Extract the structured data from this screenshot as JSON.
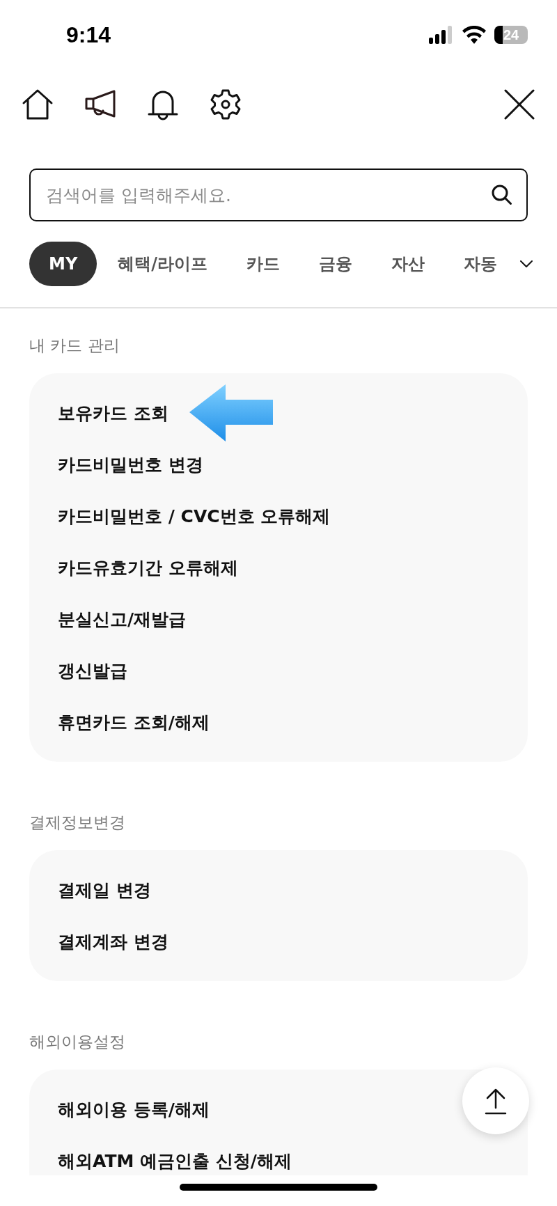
{
  "status_bar": {
    "time": "9:14",
    "battery": "24"
  },
  "search": {
    "placeholder": "검색어를 입력해주세요."
  },
  "tabs": [
    {
      "label": "MY",
      "selected": true
    },
    {
      "label": "혜택/라이프",
      "selected": false
    },
    {
      "label": "카드",
      "selected": false
    },
    {
      "label": "금융",
      "selected": false
    },
    {
      "label": "자산",
      "selected": false
    },
    {
      "label": "자동",
      "selected": false
    }
  ],
  "sections": [
    {
      "title": "내 카드 관리",
      "items": [
        {
          "label": "보유카드 조회",
          "pointed": true
        },
        {
          "label": "카드비밀번호 변경",
          "pointed": false
        },
        {
          "label": "카드비밀번호 / CVC번호 오류해제",
          "pointed": false
        },
        {
          "label": "카드유효기간 오류해제",
          "pointed": false
        },
        {
          "label": "분실신고/재발급",
          "pointed": false
        },
        {
          "label": "갱신발급",
          "pointed": false
        },
        {
          "label": "휴면카드 조회/해제",
          "pointed": false
        }
      ]
    },
    {
      "title": "결제정보변경",
      "items": [
        {
          "label": "결제일 변경",
          "pointed": false
        },
        {
          "label": "결제계좌 변경",
          "pointed": false
        }
      ]
    },
    {
      "title": "해외이용설정",
      "items": [
        {
          "label": "해외이용 등록/해제",
          "pointed": false
        },
        {
          "label": "해외ATM 예금인출 신청/해제",
          "pointed": false
        }
      ]
    }
  ]
}
